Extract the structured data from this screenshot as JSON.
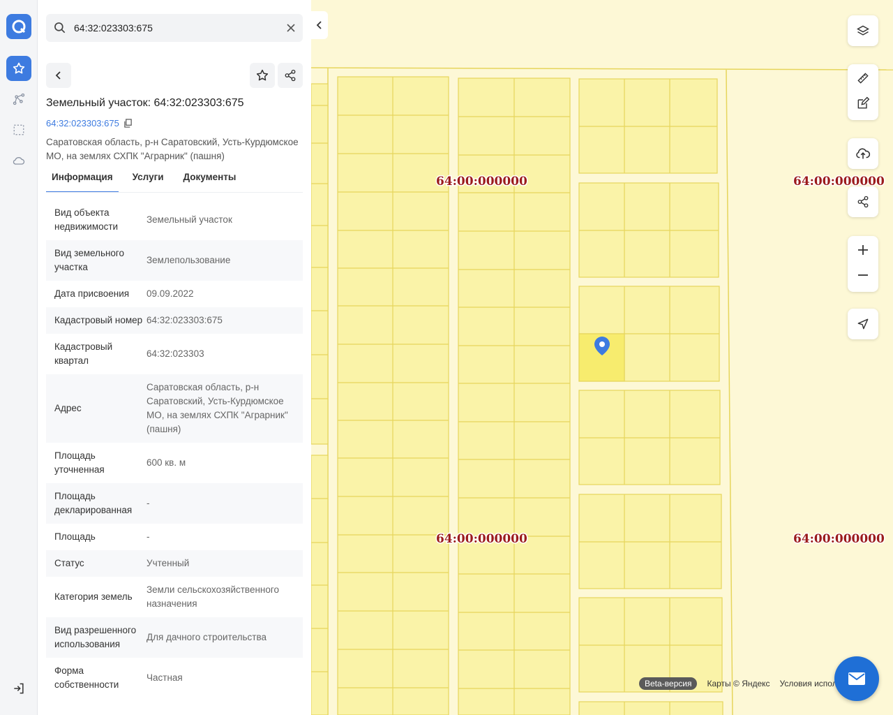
{
  "search": {
    "value": "64:32:023303:675"
  },
  "object": {
    "title": "Земельный участок: 64:32:023303:675",
    "cad_number": "64:32:023303:675",
    "address": "Саратовская область, р-н Саратовский, Усть-Курдюмское МО, на землях СХПК \"Аграрник\" (пашня)"
  },
  "tabs": [
    {
      "label": "Информация",
      "active": true
    },
    {
      "label": "Услуги",
      "active": false
    },
    {
      "label": "Документы",
      "active": false
    }
  ],
  "info_rows": [
    {
      "key": "Вид объекта недвижимости",
      "value": "Земельный участок"
    },
    {
      "key": "Вид земельного участка",
      "value": "Землепользование"
    },
    {
      "key": "Дата присвоения",
      "value": "09.09.2022"
    },
    {
      "key": "Кадастровый номер",
      "value": "64:32:023303:675"
    },
    {
      "key": "Кадастровый квартал",
      "value": "64:32:023303"
    },
    {
      "key": "Адрес",
      "value": "Саратовская область, р-н Саратовский, Усть-Курдюмское МО, на землях СХПК \"Аграрник\" (пашня)"
    },
    {
      "key": "Площадь уточненная",
      "value": "600 кв. м"
    },
    {
      "key": "Площадь декларированная",
      "value": "-"
    },
    {
      "key": "Площадь",
      "value": "-"
    },
    {
      "key": "Статус",
      "value": "Учтенный"
    },
    {
      "key": "Категория земель",
      "value": "Земли сельскохозяйственного назначения"
    },
    {
      "key": "Вид разрешенного использования",
      "value": "Для дачного строительства"
    },
    {
      "key": "Форма собственности",
      "value": "Частная"
    }
  ],
  "map": {
    "region_label": "64:00:000000",
    "beta_label": "Beta-версия",
    "copyright": "Карты © Яндекс",
    "terms": "Условия испол",
    "colors": {
      "parcel_fill": "#faf3a8",
      "parcel_line": "#e6d55c",
      "selected": "#f7ec6e",
      "marker": "#3d7be0",
      "label": "#9b1b1b"
    }
  },
  "icons": {
    "rail": [
      "app-logo-icon",
      "star-icon",
      "route-icon",
      "select-area-icon",
      "cloud-icon",
      "logout-icon"
    ],
    "map_controls": [
      "layers-icon",
      "ruler-icon",
      "edit-icon",
      "upload-icon",
      "share-icon",
      "zoom-in-icon",
      "zoom-out-icon",
      "geolocation-icon"
    ]
  }
}
